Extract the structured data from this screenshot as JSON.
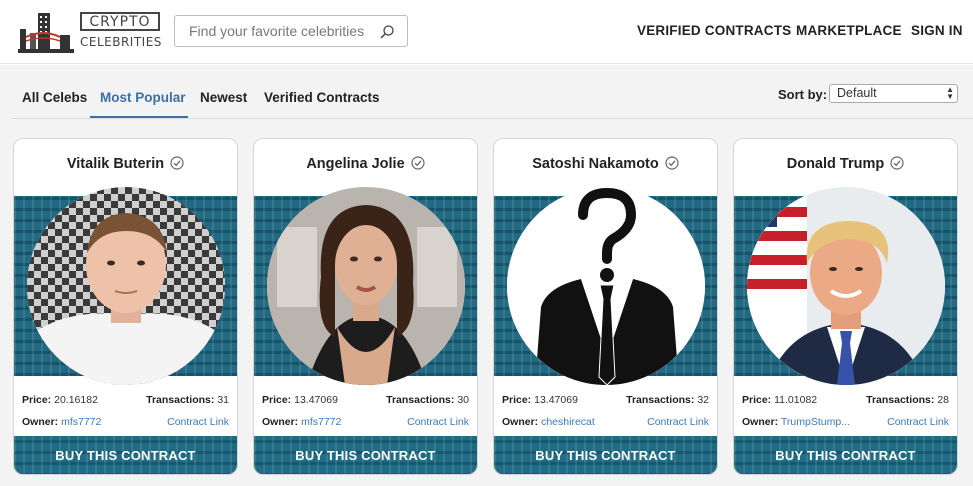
{
  "header": {
    "logo_title": "CRYPTO",
    "logo_subtitle": "CELEBRITIES",
    "search_placeholder": "Find your favorite celebrities",
    "nav": {
      "verified": "VERIFIED CONTRACTS",
      "marketplace": "MARKETPLACE",
      "signin": "SIGN IN"
    }
  },
  "tabs": [
    {
      "label": "All Celebs",
      "active": false
    },
    {
      "label": "Most Popular",
      "active": true
    },
    {
      "label": "Newest",
      "active": false
    },
    {
      "label": "Verified Contracts",
      "active": false
    }
  ],
  "sort": {
    "label": "Sort by:",
    "value": "Default"
  },
  "labels": {
    "price": "Price:",
    "transactions": "Transactions:",
    "owner": "Owner:",
    "contract_link": "Contract Link",
    "buy": "BUY THIS CONTRACT"
  },
  "cards": [
    {
      "name": "Vitalik Buterin",
      "price": "20.16182",
      "transactions": "31",
      "owner": "mfs7772"
    },
    {
      "name": "Angelina Jolie",
      "price": "13.47069",
      "transactions": "30",
      "owner": "mfs7772"
    },
    {
      "name": "Satoshi Nakamoto",
      "price": "13.47069",
      "transactions": "32",
      "owner": "cheshirecat"
    },
    {
      "name": "Donald Trump",
      "price": "11.01082",
      "transactions": "28",
      "owner": "TrumpStump..."
    }
  ],
  "colors": {
    "accent": "#3b6fa6",
    "card_band": "#226a82",
    "link": "#3b7bbf"
  }
}
